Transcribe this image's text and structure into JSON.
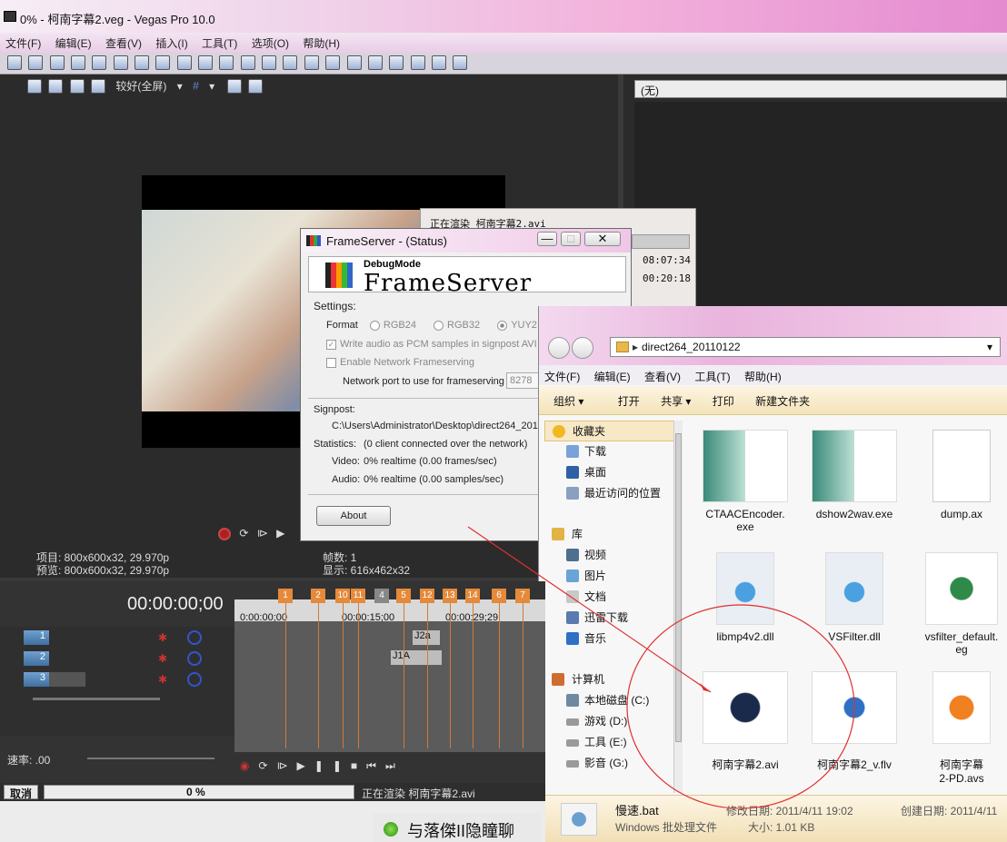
{
  "window": {
    "title": "0% - 柯南字幕2.veg - Vegas Pro 10.0"
  },
  "menu": [
    "文件(F)",
    "编辑(E)",
    "查看(V)",
    "插入(I)",
    "工具(T)",
    "选项(O)",
    "帮助(H)"
  ],
  "preview": {
    "quality": "较好(全屏)",
    "project_label": "项目: 800x600x32, 29.970p",
    "preview_label": "预览: 800x600x32, 29.970p",
    "frame_label": "帧数: 1",
    "display_label": "显示: 616x462x32"
  },
  "right_panel": {
    "dropdown_value": "(无)"
  },
  "render_box": {
    "label": "正在渲染 柯南字幕2.avi",
    "time1": "08:07:34",
    "time2": "00:20:18"
  },
  "frameserver": {
    "title": "FrameServer - (Status)",
    "logo_small": "DebugMode",
    "logo_large": "FrameServer",
    "settings_label": "Settings:",
    "format_label": "Format",
    "format_options": [
      "RGB24",
      "RGB32",
      "YUY2"
    ],
    "audio_pcm": "Write audio as PCM samples in signpost AVI",
    "network": "Enable Network Frameserving",
    "port_label": "Network port to use for frameserving",
    "port_value": "8278",
    "signpost_label": "Signpost:",
    "signpost_path": "C:\\Users\\Administrator\\Desktop\\direct264_201",
    "statistics_label": "Statistics:",
    "statistics_value": "(0 client  connected over the network)",
    "video_label": "Video:",
    "video_value": "0% realtime (0.00 frames/sec)",
    "audio_label": "Audio:",
    "audio_value": "0% realtime (0.00 samples/sec)",
    "about_button": "About"
  },
  "explorer": {
    "address": "direct264_20110122",
    "menu": [
      "文件(F)",
      "编辑(E)",
      "查看(V)",
      "工具(T)",
      "帮助(H)"
    ],
    "commands": [
      "组织 ▾",
      "打开",
      "共享 ▾",
      "打印",
      "新建文件夹"
    ],
    "nav": [
      {
        "label": "收藏夹",
        "color": "#f1b820"
      },
      {
        "label": "下载",
        "color": "#7aa2d9"
      },
      {
        "label": "桌面",
        "color": "#2f5fa6"
      },
      {
        "label": "最近访问的位置",
        "color": "#8aa0c0"
      },
      {
        "label": "库",
        "color": "#e2b345"
      },
      {
        "label": "视频",
        "color": "#4f6f8f"
      },
      {
        "label": "图片",
        "color": "#6aa3d6"
      },
      {
        "label": "文档",
        "color": "#c8c8c8"
      },
      {
        "label": "迅雷下载",
        "color": "#5a7ab0"
      },
      {
        "label": "音乐",
        "color": "#2f6fc6"
      },
      {
        "label": "计算机",
        "color": "#d06c30"
      },
      {
        "label": "本地磁盘 (C:)",
        "color": "#6f8aa0"
      },
      {
        "label": "游戏 (D:)",
        "color": "#9a9a9a"
      },
      {
        "label": "工具 (E:)",
        "color": "#9a9a9a"
      },
      {
        "label": "影音 (G:)",
        "color": "#9a9a9a"
      }
    ],
    "files": [
      {
        "name": "CTAACEncoder.\nexe"
      },
      {
        "name": "dshow2wav.exe"
      },
      {
        "name": "dump.ax"
      },
      {
        "name": "libmp4v2.dll"
      },
      {
        "name": "VSFilter.dll"
      },
      {
        "name": "vsfilter_default.\neg"
      },
      {
        "name": "柯南字幕2.avi"
      },
      {
        "name": "柯南字幕2_v.flv"
      },
      {
        "name": "柯南字幕\n2-PD.avs"
      }
    ],
    "status": {
      "filename": "慢速.bat",
      "filetype": "Windows 批处理文件",
      "modified": "修改日期: 2011/4/11 19:02",
      "size": "大小: 1.01 KB",
      "created": "创建日期: 2011/4/11"
    }
  },
  "timeline": {
    "timecode": "00:00:00;00",
    "ruler": [
      "0:00:00;00",
      "00:00:15;00",
      "00:00:29;29"
    ],
    "markers": [
      "1",
      "2",
      "10",
      "11",
      "4",
      "5",
      "12",
      "13",
      "14",
      "6",
      "7"
    ],
    "tracks": [
      "1",
      "2",
      "3"
    ],
    "clips": [
      "J2a",
      "J1A"
    ],
    "rate_label": "速率: .00"
  },
  "statusbar": {
    "cancel": "取消",
    "progress_text": "0 %",
    "progress": 0,
    "rendering": "正在渲染 柯南字幕2.avi"
  },
  "taskbar": {
    "text": "与落傑II隐瞳聊"
  }
}
